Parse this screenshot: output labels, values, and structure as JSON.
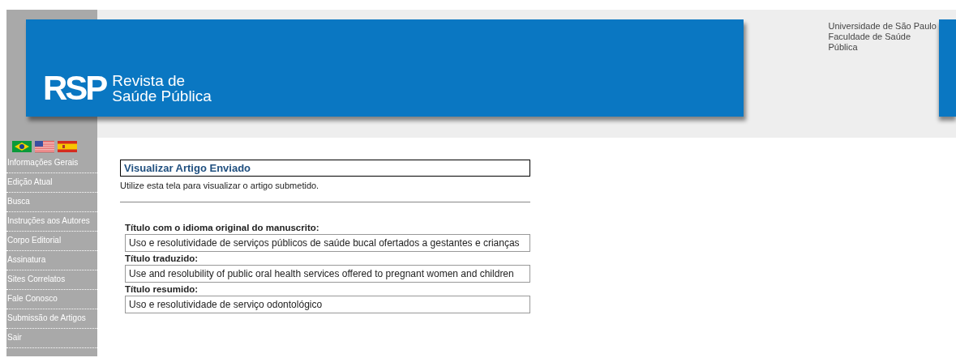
{
  "header": {
    "logo": "RSP",
    "title_lines": [
      "Revista de",
      "Saúde Pública"
    ],
    "institution_lines": [
      "Universidade de São Paulo",
      "Faculdade de Saúde Pública"
    ]
  },
  "sidebar": {
    "items": [
      {
        "label": "Informações Gerais"
      },
      {
        "label": "Edição Atual"
      },
      {
        "label": "Busca"
      },
      {
        "label": "Instruções aos Autores"
      },
      {
        "label": "Corpo Editorial"
      },
      {
        "label": "Assinatura"
      },
      {
        "label": "Sites Correlatos"
      },
      {
        "label": "Fale Conosco"
      },
      {
        "label": "Submissão de Artigos"
      },
      {
        "label": "Sair"
      }
    ]
  },
  "content": {
    "title": "Visualizar Artigo Enviado",
    "description": "Utilize esta tela para visualizar o artigo submetido.",
    "fields": [
      {
        "label": "Título com o idioma original do manuscrito:",
        "value": "Uso e resolutividade de serviços públicos de saúde bucal ofertados a gestantes e crianças"
      },
      {
        "label": "Título traduzido:",
        "value": "Use and resolubility of public oral health services offered to pregnant women and children"
      },
      {
        "label": "Título resumido:",
        "value": "Uso e resolutividade de serviço odontológico"
      }
    ]
  }
}
